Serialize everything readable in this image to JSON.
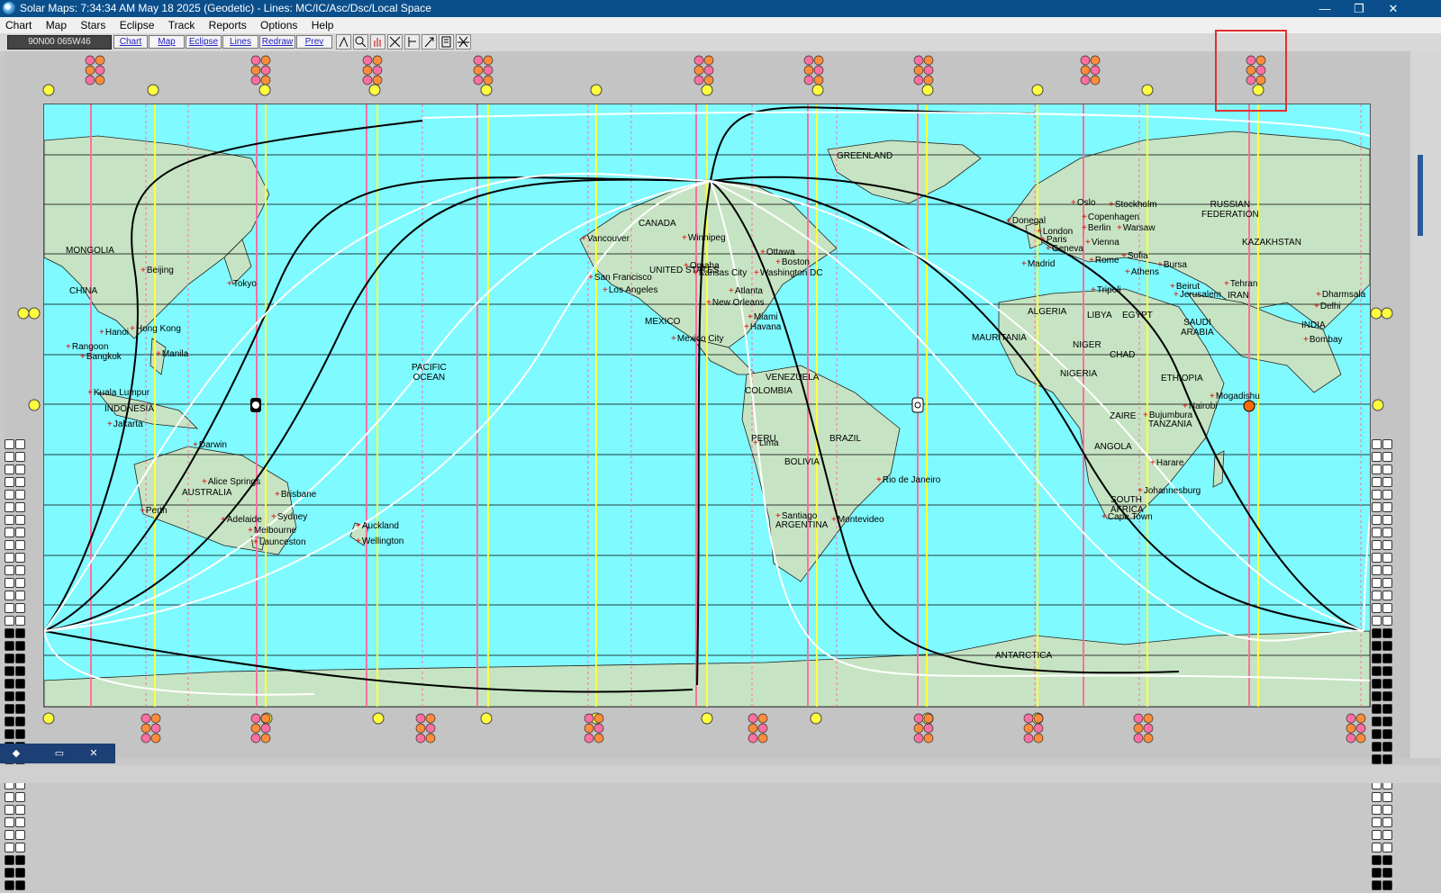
{
  "window": {
    "title": "Solar Maps: 7:34:34 AM May 18 2025 (Geodetic) - Lines: MC/IC/Asc/Dsc/Local Space",
    "minimize_icon": "minimize-icon",
    "maximize_icon": "maximize-icon",
    "close_icon": "close-icon"
  },
  "menu": [
    "Chart",
    "Map",
    "Stars",
    "Eclipse",
    "Track",
    "Reports",
    "Options",
    "Help"
  ],
  "toolbar": {
    "coordinate": "90N00 065W46",
    "buttons": [
      "Chart",
      "Map",
      "Eclipse",
      "Lines",
      "Redraw",
      "Prev"
    ],
    "tool_icons": [
      "pointer-icon",
      "zoom-icon",
      "hand-icon",
      "cross-icon",
      "line-tool-icon",
      "marker-icon",
      "list-icon",
      "axis-icon"
    ]
  },
  "map": {
    "regions": {
      "greenland": "GREENLAND",
      "canada": "CANADA",
      "russian_federation": "RUSSIAN\nFEDERATION",
      "kazakhstan": "KAZAKHSTAN",
      "mongolia": "MONGOLIA",
      "china": "CHINA",
      "mexico": "MEXICO",
      "united_states": "UNITED STATES",
      "pacific_ocean": "PACIFIC\nOCEAN",
      "indonesia": "INDONESIA",
      "australia": "AUSTRALIA",
      "venezuela": "VENEZUELA",
      "colombia": "COLOMBIA",
      "brazil": "BRAZIL",
      "peru": "PERU",
      "bolivia": "BOLIVIA",
      "argentina": "ARGENTINA",
      "algeria": "ALGERIA",
      "libya": "LIBYA",
      "egypt": "EGYPT",
      "mauritania": "MAURITANIA",
      "niger": "NIGER",
      "nigeria": "NIGERIA",
      "chad": "CHAD",
      "ethiopia": "ETHIOPIA",
      "saudi_arabia": "SAUDI\nARABIA",
      "iran": "IRAN",
      "india": "INDIA",
      "zaire": "ZAIRE",
      "tanzania": "TANZANIA",
      "angola": "ANGOLA",
      "south_africa": "SOUTH\nAFRICA",
      "antarctica": "ANTARCTICA"
    },
    "cities": {
      "beijing": "Beijing",
      "tokyo": "Tokyo",
      "hanoi": "Hanoi",
      "hong_kong": "Hong Kong",
      "rangoon": "Rangoon",
      "bangkok": "Bangkok",
      "manila": "Manila",
      "kuala_lumpur": "Kuala Lumpur",
      "jakarta": "Jakarta",
      "darwin": "Darwin",
      "alice_springs": "Alice Springs",
      "brisbane": "Brisbane",
      "perth": "Perth",
      "adelaide": "Adelaide",
      "sydney": "Sydney",
      "melbourne": "Melbourne",
      "launceston": "Launceston",
      "auckland": "Auckland",
      "wellington": "Wellington",
      "vancouver": "Vancouver",
      "san_francisco": "San Francisco",
      "los_angeles": "Los Angeles",
      "winnipeg": "Winnipeg",
      "omaha": "Omaha",
      "kansas_city": "Kansas City",
      "ottawa": "Ottawa",
      "boston": "Boston",
      "washington": "Washington DC",
      "atlanta": "Atlanta",
      "new_orleans": "New Orleans",
      "miami": "Miami",
      "havana": "Havana",
      "mexico_city": "Mexico City",
      "lima": "Lima",
      "santiago": "Santiago",
      "montevideo": "Montevideo",
      "rio": "Rio de Janeiro",
      "donegal": "Donegal",
      "london": "London",
      "paris": "Paris",
      "madrid": "Madrid",
      "oslo": "Oslo",
      "stockholm": "Stockholm",
      "copenhagen": "Copenhagen",
      "berlin": "Berlin",
      "warsaw": "Warsaw",
      "vienna": "Vienna",
      "geneva": "Geneva",
      "rome": "Rome",
      "sofia": "Sofia",
      "bursa": "Bursa",
      "athens": "Athens",
      "tripoli": "Tripoli",
      "beirut": "Beirut",
      "jerusalem": "Jerusalem",
      "tehran": "Tehran",
      "dharmsala": "Dharmsala",
      "delhi": "Delhi",
      "bombay": "Bombay",
      "mogadishu": "Mogadishu",
      "nairobi": "Nairobi",
      "bujumbura": "Bujumbura",
      "harare": "Harare",
      "johannesburg": "Johannesburg",
      "cape_town": "Cape Town"
    }
  },
  "taskbar": {
    "icons": [
      "app-taskbar-icon",
      "restore-icon",
      "close-icon"
    ]
  },
  "colors": {
    "ocean": "#7ffaff",
    "land": "#c6e4c3",
    "asc_dsc_line": "#000000",
    "local_space_line": "#ffffff",
    "mc_line": "#ff6fa0",
    "ic_line": "#ffff40",
    "dashed_mc": "#ff6fa0"
  }
}
